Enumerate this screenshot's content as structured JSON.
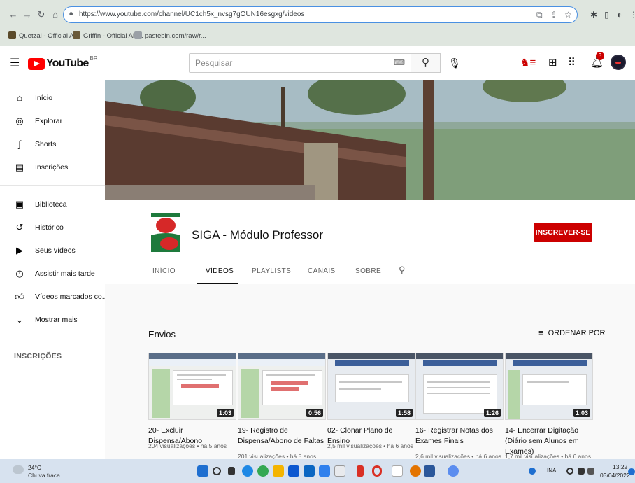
{
  "browser": {
    "url": "https://www.youtube.com/channel/UC1ch5x_nvsg7gOUN16esgxg/videos",
    "bookmarks": [
      {
        "label": "Quetzal - Official A...",
        "color": "#5a4a2a"
      },
      {
        "label": "Griffin - Official AR...",
        "color": "#6a5a3a"
      },
      {
        "label": "pastebin.com/raw/r...",
        "color": "#9aa0a6"
      }
    ]
  },
  "header": {
    "logo_text": "YouTube",
    "region": "BR",
    "search_placeholder": "Pesquisar",
    "notifications_count": "3"
  },
  "sidebar": {
    "items": [
      {
        "label": "Início",
        "icon": "home-icon"
      },
      {
        "label": "Explorar",
        "icon": "compass-icon"
      },
      {
        "label": "Shorts",
        "icon": "shorts-icon"
      },
      {
        "label": "Inscrições",
        "icon": "subscriptions-icon"
      },
      {
        "label": "Biblioteca",
        "icon": "library-icon"
      },
      {
        "label": "Histórico",
        "icon": "history-icon"
      },
      {
        "label": "Seus vídeos",
        "icon": "your-videos-icon"
      },
      {
        "label": "Assistir mais tarde",
        "icon": "watch-later-icon"
      },
      {
        "label": "Vídeos marcados co...",
        "icon": "liked-icon"
      },
      {
        "label": "Mostrar mais",
        "icon": "chevron-down-icon"
      }
    ],
    "subscriptions_title": "INSCRIÇÕES"
  },
  "channel": {
    "name": "SIGA - Módulo Professor",
    "subscribe_label": "INSCREVER-SE",
    "tabs": [
      {
        "label": "INÍCIO",
        "active": false
      },
      {
        "label": "VÍDEOS",
        "active": true
      },
      {
        "label": "PLAYLISTS",
        "active": false
      },
      {
        "label": "CANAIS",
        "active": false
      },
      {
        "label": "SOBRE",
        "active": false
      }
    ]
  },
  "content": {
    "section_title": "Envios",
    "sort_label": "ORDENAR POR",
    "videos": [
      {
        "title": "20- Excluir Dispensa/Abono",
        "meta": "204 visualizações • há 5 anos",
        "duration": "1:03"
      },
      {
        "title": "19- Registro de Dispensa/Abono de Faltas",
        "meta": "201 visualizações • há 5 anos",
        "duration": "0:56"
      },
      {
        "title": "02- Clonar Plano de Ensino",
        "meta": "2,5 mil visualizações • há 6 anos",
        "duration": "1:58"
      },
      {
        "title": "16- Registrar Notas dos Exames Finais",
        "meta": "2,6 mil visualizações • há 6 anos",
        "duration": "1:26"
      },
      {
        "title": "14- Encerrar Digitação (Diário sem Alunos em Exames)",
        "meta": "1,7 mil visualizações • há 6 anos",
        "duration": "1:03"
      }
    ]
  },
  "taskbar": {
    "temperature": "24°C",
    "weather": "Chuva fraca",
    "tray_lang": "INA",
    "time": "13:22",
    "date": "03/04/2022"
  },
  "colors": {
    "youtube_red": "#ff0000",
    "subscribe_red": "#cc0000",
    "channel_green": "#1e7a3c",
    "channel_red": "#d62828"
  }
}
